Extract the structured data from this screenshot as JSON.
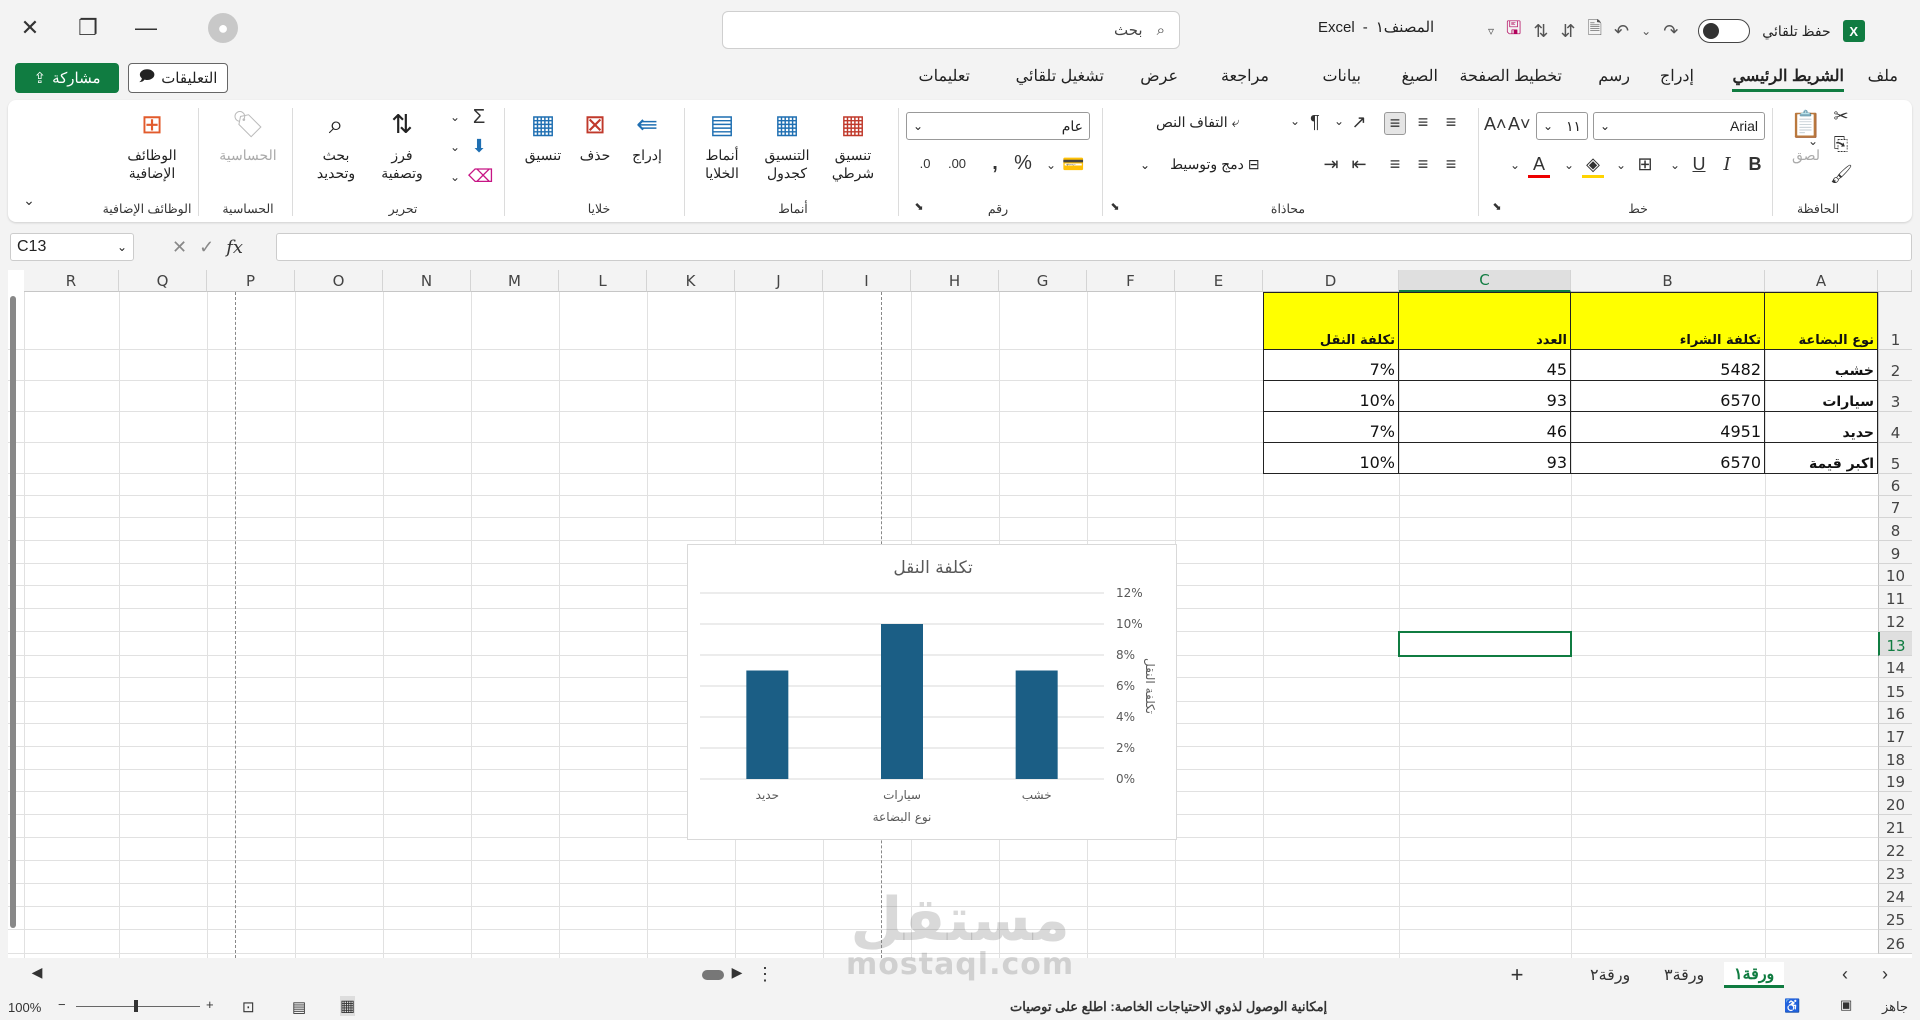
{
  "title_bar": {
    "app": "Excel",
    "doc": "المصنف١",
    "separator": "-",
    "search_placeholder": "بحث",
    "autosave_label": "حفظ تلقائي"
  },
  "tabs": [
    {
      "label": "ملف"
    },
    {
      "label": "الشريط الرئيسي"
    },
    {
      "label": "إدراج"
    },
    {
      "label": "رسم"
    },
    {
      "label": "تخطيط الصفحة"
    },
    {
      "label": "الصيغ"
    },
    {
      "label": "بيانات"
    },
    {
      "label": "مراجعة"
    },
    {
      "label": "عرض"
    },
    {
      "label": "تشغيل تلقائي"
    },
    {
      "label": "تعليمات"
    }
  ],
  "share_label": "مشاركة",
  "comments_label": "التعليقات",
  "ribbon": {
    "groups": {
      "clipboard": "الحافظة",
      "font": "خط",
      "alignment": "محاذاة",
      "number": "رقم",
      "styles": "أنماط",
      "cells": "خلايا",
      "editing": "تحرير",
      "sensitivity": "الحساسية",
      "addins": "الوظائف الإضافية"
    },
    "paste": "لصق",
    "font_name": "Arial",
    "font_size": "١١",
    "wrap_text": "التفاف النص",
    "merge_center": "دمج وتوسيط",
    "number_format": "عام",
    "conditional_1": "تنسيق",
    "conditional_2": "شرطي",
    "format_table_1": "التنسيق",
    "format_table_2": "كجدول",
    "cell_styles_1": "أنماط",
    "cell_styles_2": "الخلايا",
    "insert": "إدراج",
    "delete": "حذف",
    "format": "تنسيق",
    "sort_1": "فرز",
    "sort_2": "وتصفية",
    "find_1": "بحث",
    "find_2": "وتحديد",
    "sensitivity_btn": "الحساسية",
    "addins_1": "الوظائف",
    "addins_2": "الإضافية"
  },
  "formula_bar": {
    "name_box": "C13",
    "fx": "fx",
    "value": ""
  },
  "columns": [
    "A",
    "B",
    "C",
    "D",
    "E",
    "F",
    "G",
    "H",
    "I",
    "J",
    "K",
    "L",
    "M",
    "N",
    "O",
    "P",
    "Q",
    "R"
  ],
  "rows": [
    "1",
    "2",
    "3",
    "4",
    "5",
    "6",
    "7",
    "8",
    "9",
    "10",
    "11",
    "12",
    "13",
    "14",
    "15",
    "16",
    "17",
    "18",
    "19",
    "20",
    "21",
    "22",
    "23",
    "24",
    "25",
    "26"
  ],
  "table": {
    "headers": [
      "نوع البضاعة",
      "تكلفة الشراء",
      "العدد",
      "تكلفة النقل"
    ],
    "rows": [
      [
        "خشب",
        "5482",
        "45",
        "7%"
      ],
      [
        "سيارات",
        "6570",
        "93",
        "10%"
      ],
      [
        "حديد",
        "4951",
        "46",
        "7%"
      ],
      [
        "اكبر قيمة",
        "6570",
        "93",
        "10%"
      ]
    ]
  },
  "chart_data": {
    "type": "bar",
    "title": "تكلفة النقل",
    "categories": [
      "خشب",
      "سيارات",
      "حديد"
    ],
    "values": [
      7,
      10,
      7
    ],
    "value_unit": "%",
    "ylim": [
      0,
      12
    ],
    "yticks": [
      "0%",
      "2%",
      "4%",
      "6%",
      "8%",
      "10%",
      "12%"
    ],
    "xlabel": "نوع البضاعة",
    "ylabel": "تكلفة النقل",
    "grid": true,
    "bar_color": "#1b5e85",
    "x_axis_direction": "right-to-left",
    "y_axis_side": "right"
  },
  "sheet_tabs": [
    "ورقة١",
    "ورقة٣",
    "ورقة٢"
  ],
  "status": {
    "ready": "جاهز",
    "accessibility": "إمكانية الوصول لذوي الاحتياجات الخاصة: اطلع على توصيات",
    "zoom": "100%"
  },
  "watermark": {
    "ar": "مستقل",
    "en": "mostaql.com"
  },
  "colors": {
    "accent": "#107c41",
    "header_fill": "#ffff00"
  }
}
